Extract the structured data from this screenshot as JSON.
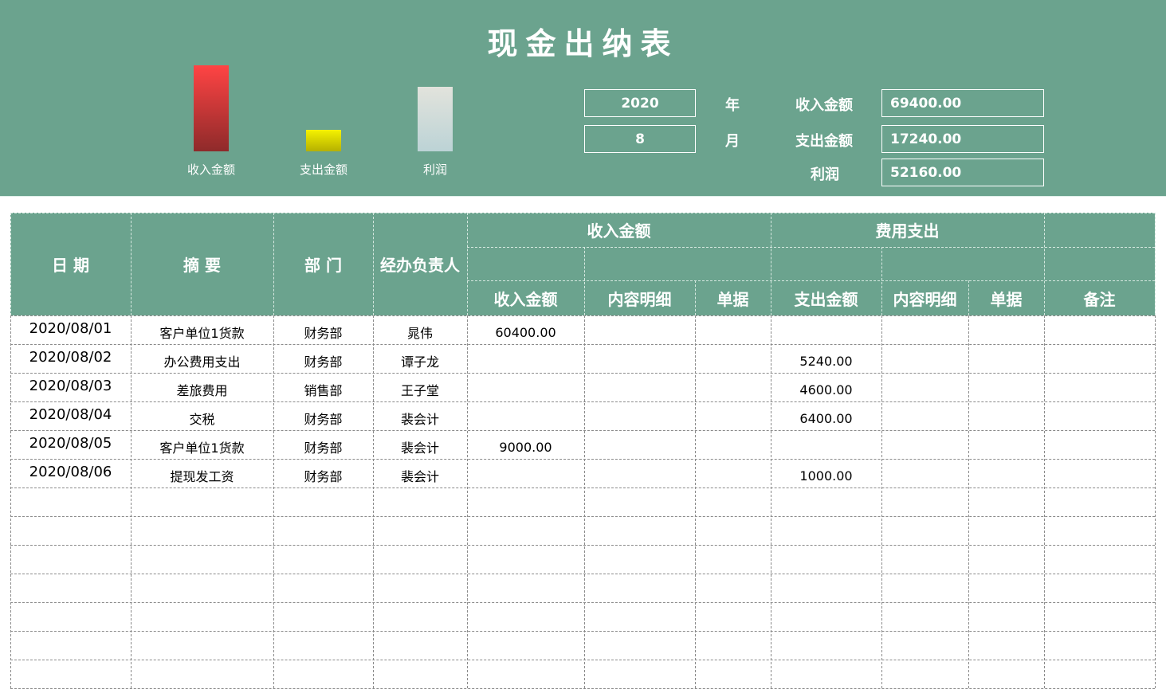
{
  "title": "现金出纳表",
  "chart_data": {
    "type": "bar",
    "categories": [
      "收入金额",
      "支出金额",
      "利润"
    ],
    "values": [
      69400.0,
      17240.0,
      52160.0
    ],
    "colors": [
      "#f24545",
      "#e8e600",
      "#dfe4de"
    ]
  },
  "summary": {
    "year_value": "2020",
    "year_label": "年",
    "month_value": "8",
    "month_label": "月",
    "income_label": "收入金额",
    "income_value": "69400.00",
    "expense_label": "支出金额",
    "expense_value": "17240.00",
    "profit_label": "利润",
    "profit_value": "52160.00"
  },
  "table": {
    "headers": {
      "date": "日  期",
      "summary": "摘    要",
      "department": "部  门",
      "handler": "经办负责人",
      "income_group": "收入金额",
      "expense_group": "费用支出",
      "income_amount": "收入金额",
      "income_detail": "内容明细",
      "income_receipt": "单据",
      "expense_amount": "支出金额",
      "expense_detail": "内容明细",
      "expense_receipt": "单据",
      "remarks": "备注"
    },
    "rows": [
      [
        "2020/08/01",
        "客户单位1货款",
        "财务部",
        "晁伟",
        "60400.00",
        "",
        "",
        "",
        "",
        "",
        ""
      ],
      [
        "2020/08/02",
        "办公费用支出",
        "财务部",
        "谭子龙",
        "",
        "",
        "",
        "5240.00",
        "",
        "",
        ""
      ],
      [
        "2020/08/03",
        "差旅费用",
        "销售部",
        "王子堂",
        "",
        "",
        "",
        "4600.00",
        "",
        "",
        ""
      ],
      [
        "2020/08/04",
        "交税",
        "财务部",
        "裴会计",
        "",
        "",
        "",
        "6400.00",
        "",
        "",
        ""
      ],
      [
        "2020/08/05",
        "客户单位1货款",
        "财务部",
        "裴会计",
        "9000.00",
        "",
        "",
        "",
        "",
        "",
        ""
      ],
      [
        "2020/08/06",
        "提现发工资",
        "财务部",
        "裴会计",
        "",
        "",
        "",
        "1000.00",
        "",
        "",
        ""
      ],
      [
        "",
        "",
        "",
        "",
        "",
        "",
        "",
        "",
        "",
        "",
        ""
      ],
      [
        "",
        "",
        "",
        "",
        "",
        "",
        "",
        "",
        "",
        "",
        ""
      ],
      [
        "",
        "",
        "",
        "",
        "",
        "",
        "",
        "",
        "",
        "",
        ""
      ],
      [
        "",
        "",
        "",
        "",
        "",
        "",
        "",
        "",
        "",
        "",
        ""
      ],
      [
        "",
        "",
        "",
        "",
        "",
        "",
        "",
        "",
        "",
        "",
        ""
      ],
      [
        "",
        "",
        "",
        "",
        "",
        "",
        "",
        "",
        "",
        "",
        ""
      ],
      [
        "",
        "",
        "",
        "",
        "",
        "",
        "",
        "",
        "",
        "",
        ""
      ]
    ]
  }
}
